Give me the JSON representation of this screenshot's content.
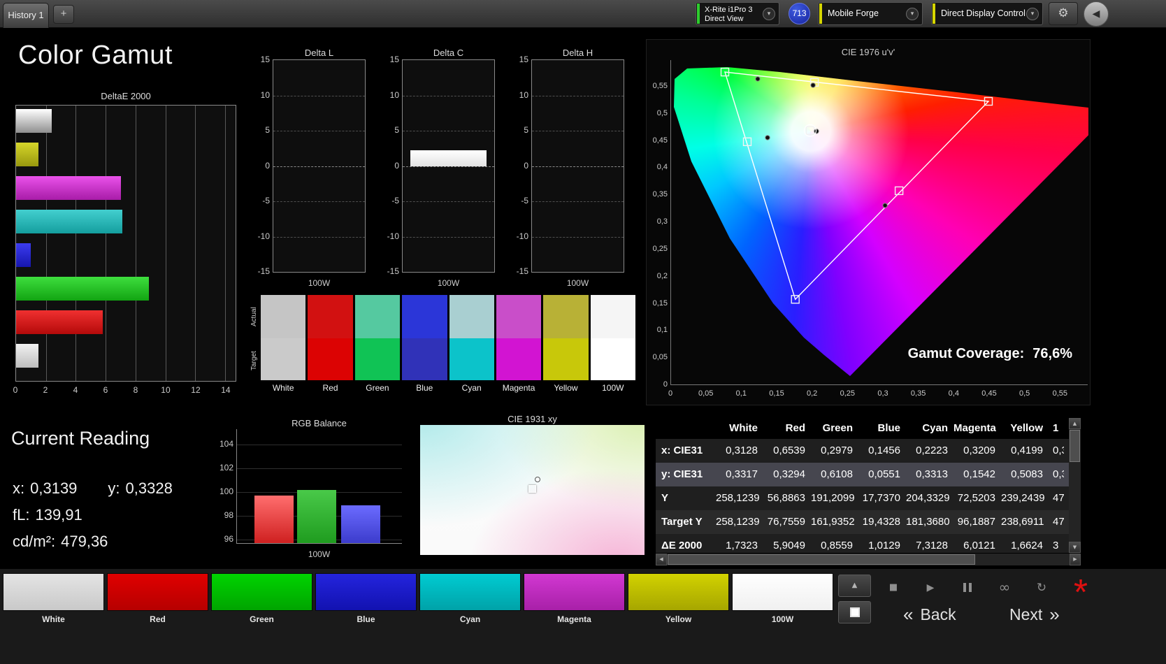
{
  "topbar": {
    "tab_label": "History 1",
    "add_tab_label": "+",
    "meter_line1": "X-Rite i1Pro 3",
    "meter_line2": "Direct View",
    "badge": "713",
    "source_label": "Mobile Forge",
    "control_label": "Direct Display Control",
    "meter_accent_color": "#2ecc2e",
    "source_accent_color": "#d6d600",
    "control_accent_color": "#d6d600"
  },
  "title": "Color Gamut",
  "icons": {
    "chevron_down": "▾",
    "gear": "⚙",
    "back_circle": "◀",
    "up": "▲",
    "stop": "■",
    "play": "▶",
    "infinity": "∞",
    "refresh": "↻",
    "asterisk": "*",
    "scroll_up": "▲",
    "scroll_down": "▼",
    "scroll_left": "◀",
    "scroll_right": "▶"
  },
  "deltae_chart": {
    "type": "bar",
    "title": "DeltaE 2000",
    "orientation": "horizontal",
    "categories": [
      "White",
      "Yellow",
      "Magenta",
      "Cyan",
      "Blue",
      "Green",
      "Red",
      "100W"
    ],
    "values": [
      2.4,
      1.5,
      7.0,
      7.1,
      1.0,
      8.9,
      5.8,
      1.5
    ],
    "bar_colors": [
      [
        "#ffffff",
        "#8f8f8f"
      ],
      [
        "#d6d62a",
        "#98980e"
      ],
      [
        "#ea52ea",
        "#a81ca8"
      ],
      [
        "#43cfcf",
        "#149e9e"
      ],
      [
        "#3c3cf0",
        "#1616ae"
      ],
      [
        "#3ede3e",
        "#12a412"
      ],
      [
        "#f03030",
        "#b40a0a"
      ],
      [
        "#f2f2f2",
        "#bdbdbd"
      ]
    ],
    "xlim": [
      0,
      14
    ],
    "xticks": [
      0,
      2,
      4,
      6,
      8,
      10,
      12,
      14
    ]
  },
  "delta_charts": [
    {
      "type": "bar",
      "title": "Delta L",
      "value": null,
      "xlabel": "100W",
      "ylim": [
        -15,
        15
      ],
      "yticks": [
        15,
        10,
        5,
        0,
        -5,
        -10,
        -15
      ]
    },
    {
      "type": "bar",
      "title": "Delta C",
      "value": 2.2,
      "xlabel": "100W",
      "ylim": [
        -15,
        15
      ],
      "yticks": [
        15,
        10,
        5,
        0,
        -5,
        -10,
        -15
      ]
    },
    {
      "type": "bar",
      "title": "Delta H",
      "value": null,
      "xlabel": "100W",
      "ylim": [
        -15,
        15
      ],
      "yticks": [
        15,
        10,
        5,
        0,
        -5,
        -10,
        -15
      ]
    }
  ],
  "swatch_compare": {
    "row_labels": [
      "Actual",
      "Target"
    ],
    "columns": [
      {
        "label": "White",
        "actual": "#c5c5c5",
        "target": "#cacaca"
      },
      {
        "label": "Red",
        "actual": "#d21111",
        "target": "#dc0303"
      },
      {
        "label": "Green",
        "actual": "#55c9a0",
        "target": "#10c355"
      },
      {
        "label": "Blue",
        "actual": "#2b36d8",
        "target": "#3032b8"
      },
      {
        "label": "Cyan",
        "actual": "#a9cfd1",
        "target": "#0cc3ca"
      },
      {
        "label": "Magenta",
        "actual": "#c94ec9",
        "target": "#d214d2"
      },
      {
        "label": "Yellow",
        "actual": "#b8b136",
        "target": "#c8c80a"
      },
      {
        "label": "100W",
        "actual": "#f5f5f5",
        "target": "#ffffff"
      }
    ]
  },
  "cie1976": {
    "type": "scatter",
    "title": "CIE 1976 u'v'",
    "xticks": [
      "0",
      "0,05",
      "0,1",
      "0,15",
      "0,2",
      "0,25",
      "0,3",
      "0,35",
      "0,4",
      "0,45",
      "0,5",
      "0,55"
    ],
    "yticks": [
      "0,55",
      "0,5",
      "0,45",
      "0,4",
      "0,35",
      "0,3",
      "0,25",
      "0,2",
      "0,15",
      "0,1",
      "0,05",
      "0"
    ],
    "coverage_label": "Gamut Coverage:",
    "coverage_value": "76,6%",
    "triangle": {
      "red": [
        0.448,
        0.523
      ],
      "green": [
        0.076,
        0.577
      ],
      "blue": [
        0.1754,
        0.158
      ]
    },
    "target_points": [
      [
        0.076,
        0.577
      ],
      [
        0.2024,
        0.558
      ],
      [
        0.448,
        0.523
      ],
      [
        0.1076,
        0.4485
      ],
      [
        0.3218,
        0.3583
      ],
      [
        0.1754,
        0.158
      ],
      [
        0.1964,
        0.4691
      ]
    ],
    "measured_points": [
      [
        0.1224,
        0.5644
      ],
      [
        0.2004,
        0.5528
      ],
      [
        0.1362,
        0.4562
      ],
      [
        0.3021,
        0.3312
      ],
      [
        0.2053,
        0.4678
      ]
    ],
    "white_point": [
      0.1964,
      0.4691
    ]
  },
  "reading": {
    "title": "Current Reading",
    "x_label": "x:",
    "x_value": "0,3139",
    "y_label": "y:",
    "y_value": "0,3328",
    "fl_label": "fL:",
    "fl_value": "139,91",
    "cd_label": "cd/m²:",
    "cd_value": "479,36"
  },
  "rgb_balance": {
    "type": "bar",
    "title": "RGB Balance",
    "categories": [
      "Red",
      "Green",
      "Blue"
    ],
    "values": [
      99.7,
      100.2,
      98.9
    ],
    "bar_colors": [
      [
        "#ff6e6e",
        "#cf2020"
      ],
      [
        "#49c949",
        "#1f9c1f"
      ],
      [
        "#6b6bff",
        "#3c3ccc"
      ]
    ],
    "yticks": [
      104,
      102,
      100,
      98,
      96
    ],
    "xlabel": "100W"
  },
  "cie1931": {
    "title": "CIE 1931 xy"
  },
  "table": {
    "columns": [
      "",
      "White",
      "Red",
      "Green",
      "Blue",
      "Cyan",
      "Magenta",
      "Yellow"
    ],
    "partial_header": "1",
    "rows": [
      {
        "label": "x: CIE31",
        "values": [
          "0,3128",
          "0,6539",
          "0,2979",
          "0,1456",
          "0,2223",
          "0,3209",
          "0,4199"
        ],
        "partial": "0,3",
        "selected": false
      },
      {
        "label": "y: CIE31",
        "values": [
          "0,3317",
          "0,3294",
          "0,6108",
          "0,0551",
          "0,3313",
          "0,1542",
          "0,5083"
        ],
        "partial": "0,3",
        "selected": true
      },
      {
        "label": "Y",
        "values": [
          "258,1239",
          "56,8863",
          "191,2099",
          "17,7370",
          "204,3329",
          "72,5203",
          "239,2439"
        ],
        "partial": "47",
        "selected": false
      },
      {
        "label": "Target Y",
        "values": [
          "258,1239",
          "76,7559",
          "161,9352",
          "19,4328",
          "181,3680",
          "96,1887",
          "238,6911"
        ],
        "partial": "47",
        "selected": false
      },
      {
        "label": "ΔE 2000",
        "values": [
          "1,7323",
          "5,9049",
          "0,8559",
          "1,0129",
          "7,3128",
          "6,0121",
          "1,6624"
        ],
        "partial": "3",
        "selected": false
      }
    ]
  },
  "bottom": {
    "patches": [
      {
        "label": "White",
        "top": "#e4e4e4",
        "bottom": "#c9c9c9"
      },
      {
        "label": "Red",
        "top": "#e00000",
        "bottom": "#b60000"
      },
      {
        "label": "Green",
        "top": "#00d400",
        "bottom": "#00a400"
      },
      {
        "label": "Blue",
        "top": "#2424dd",
        "bottom": "#1212b0"
      },
      {
        "label": "Cyan",
        "top": "#00ccd2",
        "bottom": "#00a2a8"
      },
      {
        "label": "Magenta",
        "top": "#d238d2",
        "bottom": "#a820a8"
      },
      {
        "label": "Yellow",
        "top": "#d2d200",
        "bottom": "#a6a600"
      },
      {
        "label": "100W",
        "top": "#ffffff",
        "bottom": "#f0f0f0"
      }
    ],
    "back_chevrons": "«",
    "back_label": "Back",
    "next_label": "Next",
    "next_chevrons": "»"
  }
}
